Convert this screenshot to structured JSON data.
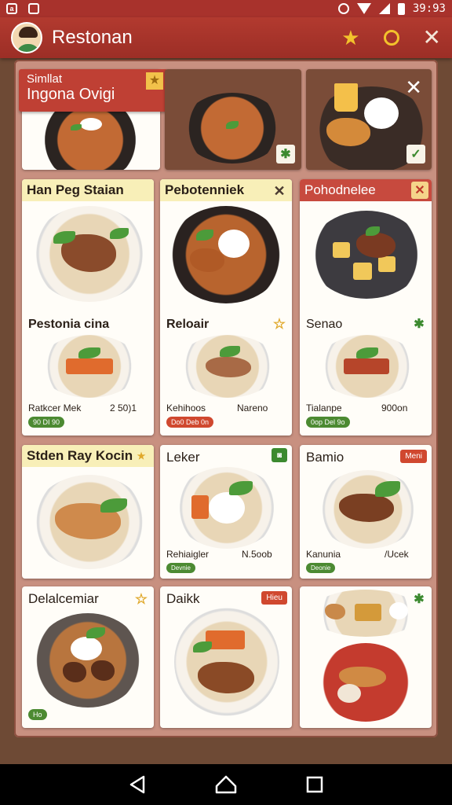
{
  "status": {
    "time": "39:93",
    "left_icon_label": "a"
  },
  "app": {
    "title": "Restonan"
  },
  "featured": {
    "label_line1": "Simllat",
    "label_line2": "Ingona Ovigi"
  },
  "cards": [
    {
      "title": "Han Peg Staian",
      "sub_title": "Pestonia cina",
      "price_name": "Ratkcer Mek",
      "price": "2 50)1",
      "pill": "90 DI 90"
    },
    {
      "title": "Pebotenniek",
      "sub_title": "Reloair",
      "price_name": "Kehihoos",
      "price": "Nareno",
      "pill": "Do0 Deb 0n"
    },
    {
      "title": "Pohodnelee",
      "sub_title": "Senao",
      "price_name": "Tialanpe",
      "price": "900on",
      "pill": "0op Del 9o"
    },
    {
      "title": "Stden Ray Kocin"
    },
    {
      "title": "Leker",
      "price_name": "Rehiaigler",
      "price": "N.5oob",
      "pill": "Devnie"
    },
    {
      "title": "Bamio",
      "badge": "Meni",
      "price_name": "Kanunia",
      "price": "/Ucek",
      "pill": "Deonie"
    },
    {
      "title": "Delalcemiar",
      "pill": "Ho"
    },
    {
      "title": "Daikk",
      "badge": "Hieu"
    },
    {
      "title": ""
    }
  ]
}
